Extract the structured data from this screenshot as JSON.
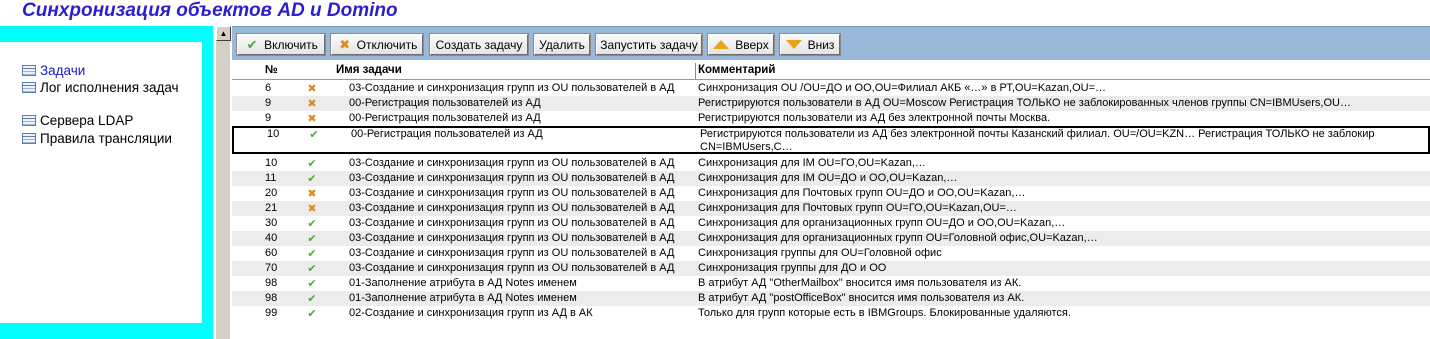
{
  "window": {
    "title": "Синхронизация объектов AD и Domino"
  },
  "nav": {
    "items": [
      {
        "label": "Задачи",
        "icon": "table-icon",
        "active": true
      },
      {
        "label": "Лог исполнения задач",
        "icon": "table-icon",
        "active": false
      },
      {
        "label": "Сервера LDAP",
        "icon": "table-icon",
        "active": false
      },
      {
        "label": "Правила трансляции",
        "icon": "table-icon",
        "active": false
      }
    ]
  },
  "toolbar": {
    "enable": "Включить",
    "disable": "Отключить",
    "create": "Создать задачу",
    "delete": "Удалить",
    "run": "Запустить задачу",
    "up": "Вверх",
    "down": "Вниз"
  },
  "grid": {
    "columns": {
      "num": "№",
      "name": "Имя задачи",
      "comment": "Комментарий"
    },
    "rows": [
      {
        "num": "6",
        "status": "off",
        "name": "03-Создание и синхронизация групп из OU пользователей в АД",
        "comment": "Синхронизация OU /OU=ДО и ОО,OU=Филиал АКБ «…» в РТ,OU=Kazan,OU=…"
      },
      {
        "num": "9",
        "status": "off",
        "name": "00-Регистрация пользователей из АД",
        "comment": "Регистрируются пользователи в АД OU=Moscow Регистрация ТОЛЬКО не заблокированных членов группы CN=IBMUsers,OU…"
      },
      {
        "num": "9",
        "status": "off",
        "name": "00-Регистрация пользователей из АД",
        "comment": "Регистрируются пользователи из АД без электронной почты Москва."
      },
      {
        "num": "10",
        "status": "on",
        "name": "00-Регистрация пользователей из АД",
        "comment": "Регистрируются пользователи из АД без электронной почты Казанский филиал. OU=/OU=KZN… Регистрация ТОЛЬКО не заблокир",
        "comment2": "CN=IBMUsers,C…",
        "selected": true
      },
      {
        "num": "10",
        "status": "on",
        "name": "03-Создание и синхронизация групп из OU пользователей в АД",
        "comment": "Синхронизация для IM OU=ГО,OU=Kazan,…"
      },
      {
        "num": "11",
        "status": "on",
        "name": "03-Создание и синхронизация групп из OU пользователей в АД",
        "comment": "Синхронизация для IM OU=ДО и ОО,OU=Kazan,…"
      },
      {
        "num": "20",
        "status": "off",
        "name": "03-Создание и синхронизация групп из OU пользователей в АД",
        "comment": "Синхронизация для Почтовых групп OU=ДО и ОО,OU=Kazan,…"
      },
      {
        "num": "21",
        "status": "off",
        "name": "03-Создание и синхронизация групп из OU пользователей в АД",
        "comment": "Синхронизация для Почтовых групп OU=ГО,OU=Kazan,OU=…"
      },
      {
        "num": "30",
        "status": "on",
        "name": "03-Создание и синхронизация групп из OU пользователей в АД",
        "comment": "Синхронизация для организационных групп OU=ДО и ОО,OU=Kazan,…"
      },
      {
        "num": "40",
        "status": "on",
        "name": "03-Создание и синхронизация групп из OU пользователей в АД",
        "comment": "Синхронизация для организационных групп  OU=Головной офис,OU=Kazan,…"
      },
      {
        "num": "60",
        "status": "on",
        "name": "03-Создание и синхронизация групп из OU пользователей в АД",
        "comment": "Синхронизация группы для OU=Головной офис"
      },
      {
        "num": "70",
        "status": "on",
        "name": "03-Создание и синхронизация групп из OU пользователей в АД",
        "comment": "Синхронизация группы для ДО и ОО"
      },
      {
        "num": "98",
        "status": "on",
        "name": "01-Заполнение атрибута в АД Notes именем",
        "comment": "В атрибут АД \"OtherMailbox\" вносится имя пользователя из АК."
      },
      {
        "num": "98",
        "status": "on",
        "name": "01-Заполнение атрибута в АД Notes именем",
        "comment": "В атрибут АД \"postOfficeBox\" вносится имя пользователя из АК."
      },
      {
        "num": "99",
        "status": "on",
        "name": "02-Создание и синхронизация групп из АД в АК",
        "comment": "Только для групп которые есть в IBMGroups. Блокированные удаляются."
      }
    ]
  },
  "colors": {
    "title": "#2b1fcc",
    "nav_bg": "#00ffff",
    "toolbar_bg": "#9ab8d8",
    "enabled": "#43b02a",
    "disabled": "#e08a1e"
  }
}
